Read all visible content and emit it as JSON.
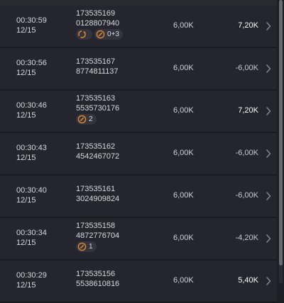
{
  "trades": [
    {
      "time": "00:30:59",
      "date": "12/15",
      "id_top": "173535169",
      "id_bottom": "0128807940",
      "amount": "6,00K",
      "result": "7,20K",
      "positive": true,
      "badges": [
        {
          "icon": "refresh-icon",
          "text": ""
        },
        {
          "icon": "shield-icon",
          "text": "0+3"
        }
      ]
    },
    {
      "time": "00:30:56",
      "date": "12/15",
      "id_top": "173535167",
      "id_bottom": "8774811137",
      "amount": "6,00K",
      "result": "-6,00K",
      "positive": false,
      "badges": []
    },
    {
      "time": "00:30:46",
      "date": "12/15",
      "id_top": "173535163",
      "id_bottom": "5535730176",
      "amount": "6,00K",
      "result": "7,20K",
      "positive": true,
      "badges": [
        {
          "icon": "shield-icon",
          "text": "2"
        }
      ]
    },
    {
      "time": "00:30:43",
      "date": "12/15",
      "id_top": "173535162",
      "id_bottom": "4542467072",
      "amount": "6,00K",
      "result": "-6,00K",
      "positive": false,
      "badges": []
    },
    {
      "time": "00:30:40",
      "date": "12/15",
      "id_top": "173535161",
      "id_bottom": "3024909824",
      "amount": "6,00K",
      "result": "-6,00K",
      "positive": false,
      "badges": []
    },
    {
      "time": "00:30:34",
      "date": "12/15",
      "id_top": "173535158",
      "id_bottom": "4872776704",
      "amount": "6,00K",
      "result": "-4,20K",
      "positive": false,
      "badges": [
        {
          "icon": "shield-icon",
          "text": "1"
        }
      ]
    },
    {
      "time": "00:30:29",
      "date": "12/15",
      "id_top": "173535156",
      "id_bottom": "5538610816",
      "amount": "6,00K",
      "result": "5,40K",
      "positive": true,
      "badges": []
    }
  ],
  "colors": {
    "row_bg": "#25252f",
    "page_bg": "#1e1e27",
    "badge_bg": "#34343f",
    "icon_orange": "#d9892d"
  }
}
